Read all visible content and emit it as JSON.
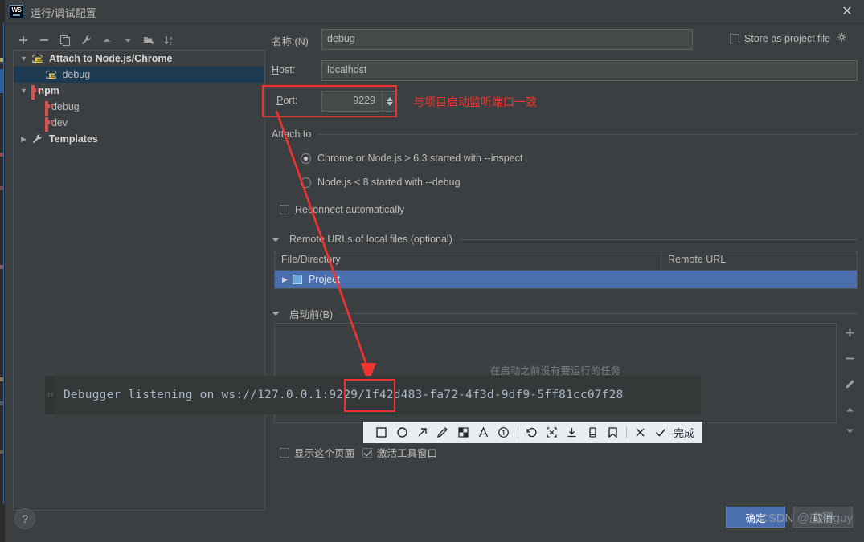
{
  "window": {
    "title": "运行/调试配置",
    "app_icon": "webstorm-icon",
    "app_icon_text": "WS",
    "close_icon": "✕"
  },
  "tree_toolbar": {
    "buttons": [
      {
        "name": "add-configuration-button",
        "icon": "plus-icon"
      },
      {
        "name": "remove-configuration-button",
        "icon": "minus-icon"
      },
      {
        "name": "copy-configuration-button",
        "icon": "copy-icon"
      },
      {
        "name": "edit-templates-button",
        "icon": "wrench-icon"
      },
      {
        "name": "move-up-button",
        "icon": "arrow-up-icon"
      },
      {
        "name": "move-down-button",
        "icon": "arrow-down-icon"
      },
      {
        "name": "new-folder-button",
        "icon": "folder-add-icon"
      },
      {
        "name": "sort-configurations-button",
        "icon": "sort-az-icon"
      }
    ]
  },
  "tree": {
    "items": [
      {
        "label": "Attach to Node.js/Chrome",
        "icon": "nodejs-js-icon",
        "indent": 0,
        "expanded": true,
        "bold": true,
        "selected": false
      },
      {
        "label": "debug",
        "icon": "nodejs-js-icon",
        "indent": 1,
        "expanded": null,
        "bold": false,
        "selected": true
      },
      {
        "label": "npm",
        "icon": "npm-icon",
        "indent": 0,
        "expanded": true,
        "bold": true,
        "selected": false
      },
      {
        "label": "debug",
        "icon": "npm-icon",
        "indent": 1,
        "expanded": null,
        "bold": false,
        "selected": false
      },
      {
        "label": "dev",
        "icon": "npm-icon",
        "indent": 1,
        "expanded": null,
        "bold": false,
        "selected": false
      },
      {
        "label": "Templates",
        "icon": "wrench-icon",
        "indent": 0,
        "expanded": false,
        "bold": true,
        "selected": false
      }
    ]
  },
  "form": {
    "name_label": "名称:(N)",
    "name_value": "debug",
    "store_as_project_file_label": "Store as project file",
    "store_as_project_file_checked": false,
    "store_gear_icon": "gear-icon",
    "host_label": "Host:",
    "host_value": "localhost",
    "port_label": "Port:",
    "port_value": "9229",
    "attach_to_label": "Attach to",
    "radio_options": [
      {
        "label": "Chrome or Node.js > 6.3 started with --inspect",
        "selected": true
      },
      {
        "label": "Node.js < 8 started with --debug",
        "selected": false
      }
    ],
    "reconnect_label": "Reconnect automatically",
    "reconnect_checked": false,
    "remote_urls_label": "Remote URLs of local files (optional)",
    "table": {
      "columns": [
        "File/Directory",
        "Remote URL"
      ],
      "rows": [
        {
          "file_directory": "Project",
          "remote_url": "",
          "selected": true,
          "icon": "project-folder-icon"
        }
      ]
    },
    "before_launch_label": "启动前(B)",
    "before_launch_empty": "在启动之前没有要运行的任务",
    "before_launch_side_buttons": [
      {
        "name": "add-task-button",
        "icon": "plus-icon"
      },
      {
        "name": "remove-task-button",
        "icon": "minus-icon"
      },
      {
        "name": "edit-task-button",
        "icon": "pencil-icon"
      },
      {
        "name": "task-move-up-button",
        "icon": "arrow-up-icon"
      },
      {
        "name": "task-move-down-button",
        "icon": "arrow-down-icon"
      }
    ],
    "show_page_label": "显示这个页面",
    "show_page_checked": false,
    "activate_tool_window_label": "激活工具窗口",
    "activate_tool_window_checked": true
  },
  "footer": {
    "ok_label": "确定",
    "cancel_label": "取消",
    "help_label": "?"
  },
  "annotations": {
    "port_note": "与项目启动监听端口一致"
  },
  "console": {
    "line_number": "19",
    "message": "Debugger listening on ws://127.0.0.1:9229/1f42d483-fa72-4f3d-9df9-5ff81cc07f28"
  },
  "anno_toolbar": {
    "tools": [
      {
        "name": "rectangle-tool",
        "icon": "square-icon"
      },
      {
        "name": "ellipse-tool",
        "icon": "circle-icon"
      },
      {
        "name": "arrow-tool",
        "icon": "arrow-up-right-icon"
      },
      {
        "name": "pen-tool",
        "icon": "pencil-icon"
      },
      {
        "name": "mosaic-tool",
        "icon": "mosaic-icon"
      },
      {
        "name": "text-tool",
        "icon": "letter-a-icon"
      },
      {
        "name": "number-tool",
        "icon": "number-circle-icon"
      }
    ],
    "actions": [
      {
        "name": "undo-button",
        "icon": "undo-icon"
      },
      {
        "name": "ocr-button",
        "icon": "ocr-brackets-icon"
      },
      {
        "name": "download-button",
        "icon": "download-icon"
      },
      {
        "name": "send-to-phone-button",
        "icon": "phone-icon"
      },
      {
        "name": "pin-button",
        "icon": "bookmark-icon"
      }
    ],
    "cancel_icon": "close-x-icon",
    "confirm_icon": "check-icon",
    "done_label": "完成"
  },
  "watermark": {
    "brand": "CSDN",
    "user": "@应程guy"
  },
  "colors": {
    "accent_blue": "#4b6eaf",
    "selection_blue": "#1c3a52",
    "annotation_red": "#f0332f",
    "panel_bg": "#3c3f41",
    "field_bg": "#45494a",
    "console_bg": "#353839",
    "console_text": "#a9b7c6",
    "npm_red": "#d9534f"
  }
}
